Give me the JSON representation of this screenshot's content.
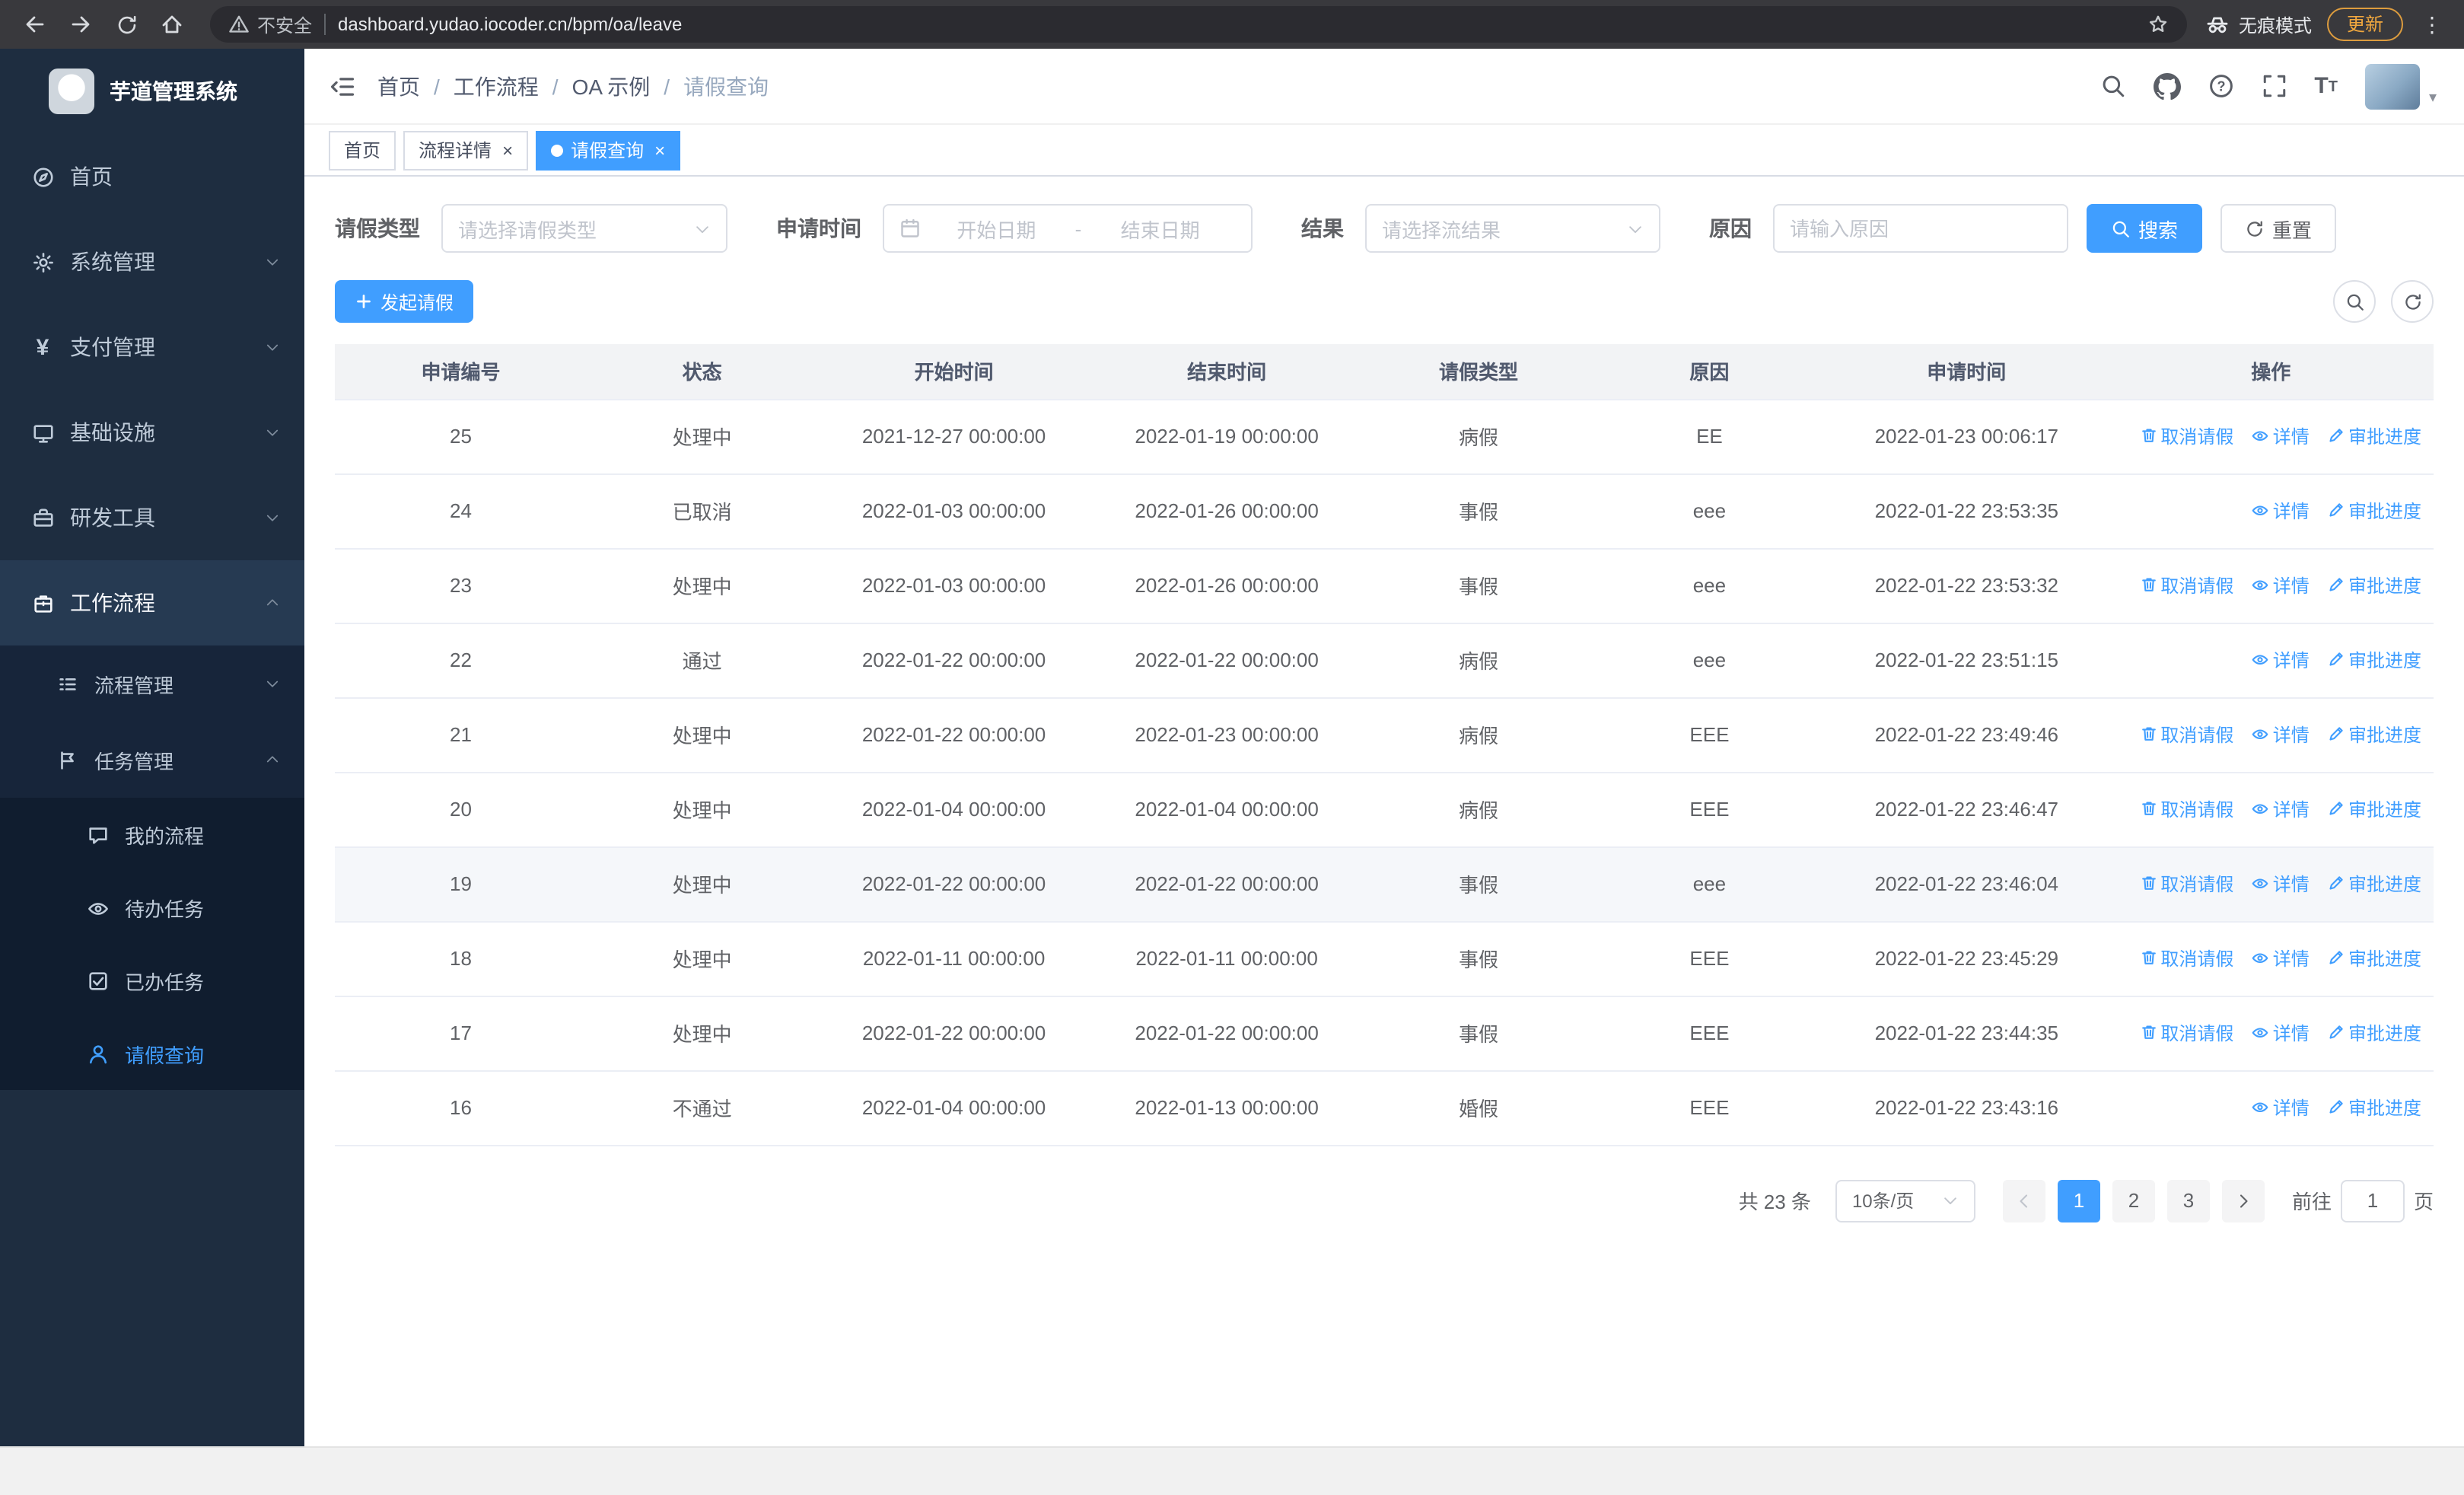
{
  "browser": {
    "security_label": "不安全",
    "url": "dashboard.yudao.iocoder.cn/bpm/oa/leave",
    "incognito_label": "无痕模式",
    "update_label": "更新"
  },
  "icons": {
    "menu_dots": "⋮",
    "caret_down": "▾",
    "yen": "¥",
    "close": "×",
    "font_large": "T",
    "font_small": "T"
  },
  "sidebar": {
    "logo_title": "芋道管理系统",
    "items": [
      {
        "label": "首页"
      },
      {
        "label": "系统管理"
      },
      {
        "label": "支付管理"
      },
      {
        "label": "基础设施"
      },
      {
        "label": "研发工具"
      },
      {
        "label": "工作流程"
      }
    ],
    "process_group": {
      "label": "流程管理"
    },
    "task_group": {
      "label": "任务管理"
    },
    "task_items": [
      {
        "label": "我的流程"
      },
      {
        "label": "待办任务"
      },
      {
        "label": "已办任务"
      },
      {
        "label": "请假查询"
      }
    ]
  },
  "header": {
    "breadcrumb": [
      "首页",
      "工作流程",
      "OA 示例",
      "请假查询"
    ],
    "separator": "/"
  },
  "tabs": [
    {
      "label": "首页"
    },
    {
      "label": "流程详情"
    },
    {
      "label": "请假查询"
    }
  ],
  "filters": {
    "leave_type_label": "请假类型",
    "leave_type_placeholder": "请选择请假类型",
    "apply_time_label": "申请时间",
    "start_placeholder": "开始日期",
    "range_separator": "-",
    "end_placeholder": "结束日期",
    "result_label": "结果",
    "result_placeholder": "请选择流结果",
    "reason_label": "原因",
    "reason_placeholder": "请输入原因",
    "search_label": "搜索",
    "reset_label": "重置"
  },
  "toolbar": {
    "create_label": "发起请假"
  },
  "table": {
    "headers": [
      "申请编号",
      "状态",
      "开始时间",
      "结束时间",
      "请假类型",
      "原因",
      "申请时间",
      "操作"
    ],
    "actions": {
      "cancel": "取消请假",
      "detail": "详情",
      "progress": "审批进度"
    },
    "rows": [
      {
        "id": "25",
        "status": "处理中",
        "start": "2021-12-27 00:00:00",
        "end": "2022-01-19 00:00:00",
        "type": "病假",
        "reason": "EE",
        "applied": "2022-01-23 00:06:17",
        "cancelable": true,
        "highlight": false
      },
      {
        "id": "24",
        "status": "已取消",
        "start": "2022-01-03 00:00:00",
        "end": "2022-01-26 00:00:00",
        "type": "事假",
        "reason": "eee",
        "applied": "2022-01-22 23:53:35",
        "cancelable": false,
        "highlight": false
      },
      {
        "id": "23",
        "status": "处理中",
        "start": "2022-01-03 00:00:00",
        "end": "2022-01-26 00:00:00",
        "type": "事假",
        "reason": "eee",
        "applied": "2022-01-22 23:53:32",
        "cancelable": true,
        "highlight": false
      },
      {
        "id": "22",
        "status": "通过",
        "start": "2022-01-22 00:00:00",
        "end": "2022-01-22 00:00:00",
        "type": "病假",
        "reason": "eee",
        "applied": "2022-01-22 23:51:15",
        "cancelable": false,
        "highlight": false
      },
      {
        "id": "21",
        "status": "处理中",
        "start": "2022-01-22 00:00:00",
        "end": "2022-01-23 00:00:00",
        "type": "病假",
        "reason": "EEE",
        "applied": "2022-01-22 23:49:46",
        "cancelable": true,
        "highlight": false
      },
      {
        "id": "20",
        "status": "处理中",
        "start": "2022-01-04 00:00:00",
        "end": "2022-01-04 00:00:00",
        "type": "病假",
        "reason": "EEE",
        "applied": "2022-01-22 23:46:47",
        "cancelable": true,
        "highlight": false
      },
      {
        "id": "19",
        "status": "处理中",
        "start": "2022-01-22 00:00:00",
        "end": "2022-01-22 00:00:00",
        "type": "事假",
        "reason": "eee",
        "applied": "2022-01-22 23:46:04",
        "cancelable": true,
        "highlight": true
      },
      {
        "id": "18",
        "status": "处理中",
        "start": "2022-01-11 00:00:00",
        "end": "2022-01-11 00:00:00",
        "type": "事假",
        "reason": "EEE",
        "applied": "2022-01-22 23:45:29",
        "cancelable": true,
        "highlight": false
      },
      {
        "id": "17",
        "status": "处理中",
        "start": "2022-01-22 00:00:00",
        "end": "2022-01-22 00:00:00",
        "type": "事假",
        "reason": "EEE",
        "applied": "2022-01-22 23:44:35",
        "cancelable": true,
        "highlight": false
      },
      {
        "id": "16",
        "status": "不通过",
        "start": "2022-01-04 00:00:00",
        "end": "2022-01-13 00:00:00",
        "type": "婚假",
        "reason": "EEE",
        "applied": "2022-01-22 23:43:16",
        "cancelable": false,
        "highlight": false
      }
    ]
  },
  "pagination": {
    "total_label": "共 23 条",
    "page_size_value": "10条/页",
    "pages": [
      "1",
      "2",
      "3"
    ],
    "goto_label": "前往",
    "goto_value": "1",
    "page_suffix": "页"
  }
}
